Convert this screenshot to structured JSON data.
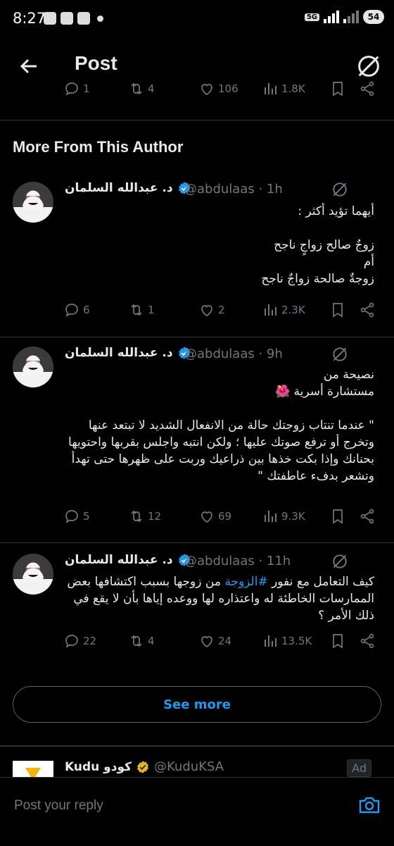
{
  "status_bar": {
    "time": "8:27",
    "network": "5G",
    "battery": "54"
  },
  "header": {
    "title": "Post"
  },
  "top_actions": {
    "replies": "1",
    "reposts": "4",
    "likes": "106",
    "views": "1.8K"
  },
  "section_title": "More From This Author",
  "tweets": [
    {
      "name": "د. عبدالله السلمان",
      "handle_time": "@abdulaas · 1h",
      "text": "أيهما تؤيد أكثر :\n\nزوجٌ صالح زواجٍ ناجح\nأم\nزوجةٌ صالحة زواجٌ ناجح",
      "replies": "6",
      "reposts": "1",
      "likes": "2",
      "views": "2.3K"
    },
    {
      "name": "د. عبدالله السلمان",
      "handle_time": "@abdulaas · 9h",
      "text": "نصيحة من\nمستشارة أسرية 🌺\n\n\" عندما تنتاب زوجتك حالة من الانفعال الشديد لا تبتعد عنها وتخرج أو ترفع صوتك عليها ؛ ولكن انتبه واجلس بقربها واحتويها بحنانك وإذا بكت خذها بين ذراعيك وربت على ظهرها حتى تهدأ وتشعر بدفء عاطفتك \"",
      "replies": "5",
      "reposts": "12",
      "likes": "69",
      "views": "9.3K"
    },
    {
      "name": "د. عبدالله السلمان",
      "handle_time": "@abdulaas · 11h",
      "text_before": "كيف التعامل مع نفور ",
      "hashtag": "#الزوجة",
      "text_after": " من زوجها بسبب اكتشافها بعض الممارسات الخاطئة له واعتذاره لها ووعده إياها بأن لا يقع في ذلك الأمر ؟",
      "replies": "22",
      "reposts": "4",
      "likes": "24",
      "views": "13.5K"
    }
  ],
  "see_more": "See more",
  "ad": {
    "name": "Kudu كودو",
    "handle": "@KuduKSA",
    "tag": "Ad"
  },
  "reply": {
    "placeholder": "Post your reply"
  },
  "icons": {
    "back": "arrow-left-icon",
    "grok": "grok-icon",
    "reply": "reply-icon",
    "repost": "repost-icon",
    "like": "heart-icon",
    "views": "views-icon",
    "bookmark": "bookmark-icon",
    "share": "share-icon",
    "verified": "verified-badge-icon",
    "camera": "camera-icon"
  },
  "colors": {
    "accent": "#1d9bf0",
    "muted": "#71767b",
    "verified": "#1d9bf0",
    "gold_verified": "#e2b719"
  }
}
